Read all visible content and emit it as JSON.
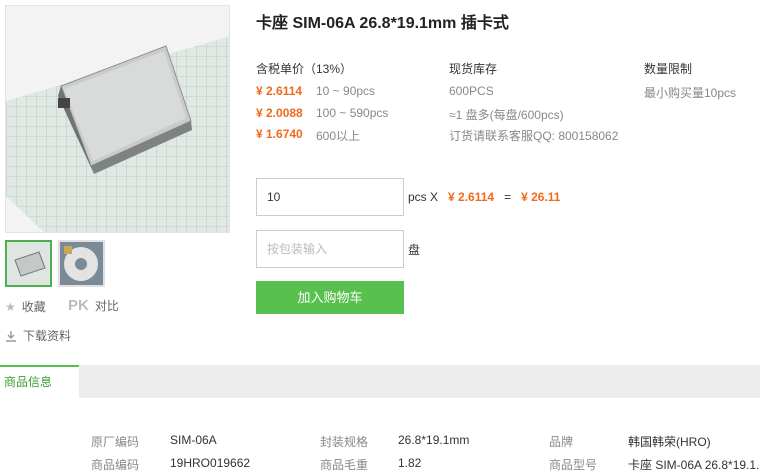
{
  "product": {
    "title": "卡座 SIM-06A 26.8*19.1mm 插卡式"
  },
  "actions": {
    "favorite_label": "收藏",
    "pk_icon_text": "PK",
    "compare_label": "对比",
    "download_label": "下载资料"
  },
  "pricing": {
    "header": "含税单价（13%）",
    "tiers": [
      {
        "price": "¥ 2.6114",
        "range": "10 ~ 90pcs"
      },
      {
        "price": "¥ 2.0088",
        "range": "100 ~ 590pcs"
      },
      {
        "price": "¥ 1.6740",
        "range": "600以上"
      }
    ]
  },
  "stock": {
    "header": "现货库存",
    "qty": "600PCS",
    "per_reel": "≈1 盘多(每盘/600pcs)",
    "contact": "订货请联系客服QQ: 800158062"
  },
  "limit": {
    "header": "数量限制",
    "text": "最小购买量10pcs"
  },
  "order": {
    "qty_value": "10",
    "unit_label": "pcs X",
    "unit_price": "¥ 2.6114",
    "equals": "=",
    "total": "¥ 26.11",
    "package_placeholder": "按包装输入",
    "package_unit": "盘",
    "cart_button": "加入购物车"
  },
  "tabs": {
    "info_label": "商品信息"
  },
  "specs": {
    "rows": [
      [
        {
          "k": "原厂编码",
          "v": "SIM-06A"
        },
        {
          "k": "封装规格",
          "v": "26.8*19.1mm"
        },
        {
          "k": "品牌",
          "v": "韩国韩荣(HRO)"
        }
      ],
      [
        {
          "k": "商品编码",
          "v": "19HRO019662"
        },
        {
          "k": "商品毛重",
          "v": "1.82"
        },
        {
          "k": "商品型号",
          "v": "卡座 SIM-06A 26.8*19.1..."
        }
      ]
    ]
  },
  "colors": {
    "accent_green": "#58c04d",
    "price_orange": "#f06a1c"
  }
}
